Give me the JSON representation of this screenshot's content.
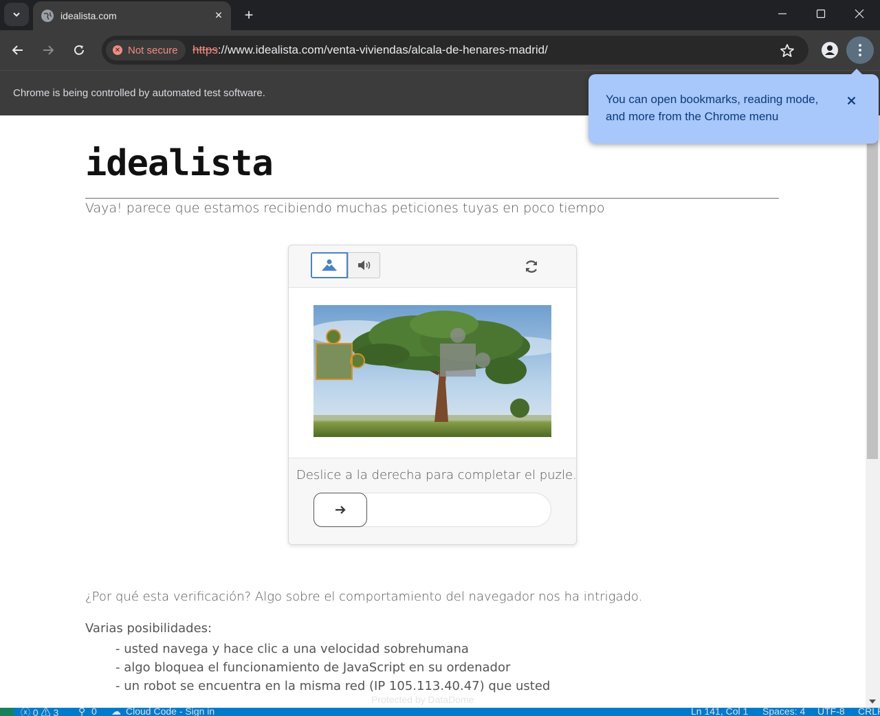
{
  "browser": {
    "tab_title": "idealista.com",
    "url_scheme": "https",
    "url_rest": "://www.idealista.com/venta-viviendas/alcala-de-henares-madrid/",
    "security_label": "Not secure",
    "infobar_message": "Chrome is being controlled by automated test software.",
    "bubble_text": "You can open bookmarks, reading mode, and more from the Chrome menu"
  },
  "page": {
    "logo": "idealista",
    "lead": "Vaya! parece que estamos recibiendo muchas peticiones tuyas en poco tiempo",
    "captcha": {
      "instruction": "Deslice a la derecha para completar el puzle."
    },
    "why": "¿Por qué esta verificación? Algo sobre el comportamiento del navegador nos ha intrigado.",
    "possibilities_title": "Varias posibilidades:",
    "possibilities": [
      "- usted navega y hace clic a una velocidad sobrehumana",
      "- algo bloquea el funcionamiento de JavaScript en su ordenador",
      "- un robot se encuentra en la misma red (IP 105.113.40.47) que usted"
    ],
    "watermark": "Protected by DataDome"
  },
  "statusbar": {
    "problems": "ⓧ 0 ⚠ 3",
    "ports": "0",
    "cloud_code": "Cloud Code - Sign in",
    "position": "Ln 141, Col 1",
    "spaces": "Spaces: 4",
    "encoding": "UTF-8",
    "eol": "CRLF"
  },
  "colors": {
    "chrome_dark": "#202124",
    "toolbar": "#3c3c3c",
    "bubble": "#a8c7fa",
    "captcha_accent": "#4a82c6"
  }
}
